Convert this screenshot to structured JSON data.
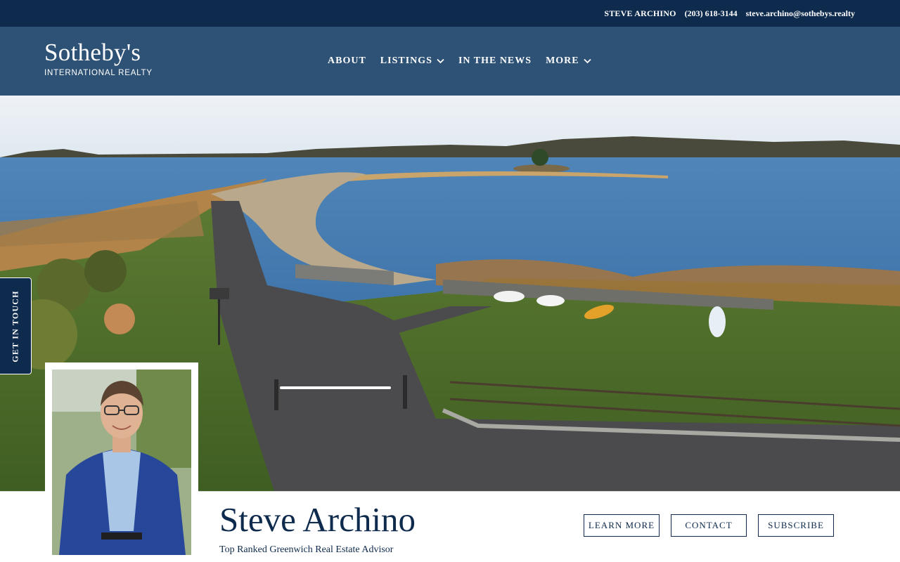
{
  "topbar": {
    "agent_name": "STEVE ARCHINO",
    "phone": "(203) 618-3144",
    "email": "steve.archino@sothebys.realty"
  },
  "header": {
    "logo_brand": "Sotheby's",
    "logo_sub": "INTERNATIONAL REALTY",
    "nav": [
      {
        "label": "ABOUT",
        "icon": null
      },
      {
        "label": "LISTINGS",
        "icon": "chevron-down-icon"
      },
      {
        "label": "IN THE NEWS",
        "icon": null
      },
      {
        "label": "MORE",
        "icon": "chevron-down-icon"
      }
    ]
  },
  "side_tab": {
    "label": "GET IN TOUCH"
  },
  "profile": {
    "name": "Steve Archino",
    "tagline": "Top Ranked Greenwich Real Estate Advisor"
  },
  "actions": {
    "learn_more": "LEARN MORE",
    "contact": "CONTACT",
    "subscribe": "SUBSCRIBE"
  },
  "colors": {
    "navy": "#0e2a4c",
    "header_blue": "#2e5275",
    "white": "#ffffff"
  }
}
